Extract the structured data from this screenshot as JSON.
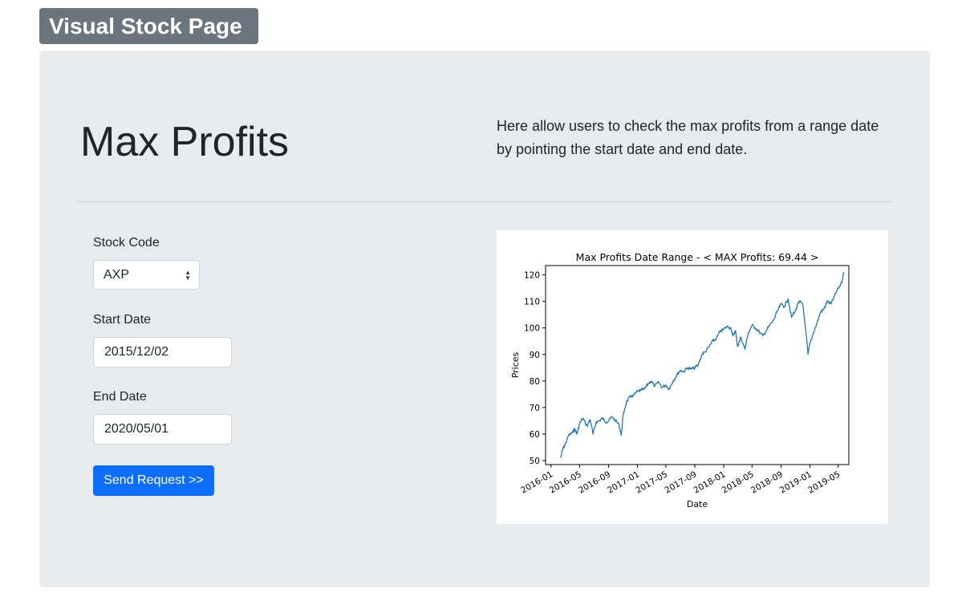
{
  "navbar": {
    "brand": "Visual Stock Page"
  },
  "hero": {
    "title": "Max Profits",
    "description": "Here allow users to check the max profits from a range date by pointing the start date and end date."
  },
  "form": {
    "stock_code_label": "Stock Code",
    "stock_code_value": "AXP",
    "start_date_label": "Start Date",
    "start_date_value": "2015/12/02",
    "end_date_label": "End Date",
    "end_date_value": "2020/05/01",
    "submit_label": "Send Request >>",
    "select_icon": "up-down-chevron-icon",
    "accent_color": "#0d6efd"
  },
  "chart_data": {
    "type": "line",
    "title": "Max Profits Date Range - < MAX Profits: 69.44 >",
    "xlabel": "Date",
    "ylabel": "Prices",
    "x_tick_labels": [
      "2016-01",
      "2016-05",
      "2016-09",
      "2017-01",
      "2017-05",
      "2017-09",
      "2018-01",
      "2018-05",
      "2018-09",
      "2019-01",
      "2019-05"
    ],
    "y_ticks": [
      50,
      60,
      70,
      80,
      90,
      100,
      110,
      120
    ],
    "ylim": [
      48.5,
      123.5
    ],
    "xlim": [
      "2015-12-09",
      "2019-06-15"
    ],
    "grid": false,
    "line_color": "#1f77b4",
    "series": [
      {
        "x": [
          "2016-02-11",
          "2016-02-20",
          "2016-03-01",
          "2016-03-15",
          "2016-04-01",
          "2016-04-10",
          "2016-04-20",
          "2016-05-01",
          "2016-05-15",
          "2016-06-01",
          "2016-06-15",
          "2016-06-27",
          "2016-07-10",
          "2016-07-25",
          "2016-08-05",
          "2016-08-20",
          "2016-09-01",
          "2016-09-15",
          "2016-10-01",
          "2016-10-15",
          "2016-10-25",
          "2016-11-01",
          "2016-11-15",
          "2016-12-01",
          "2016-12-15",
          "2017-01-01",
          "2017-01-15",
          "2017-02-01",
          "2017-02-15",
          "2017-03-01",
          "2017-03-15",
          "2017-04-01",
          "2017-04-15",
          "2017-05-01",
          "2017-05-15",
          "2017-06-01",
          "2017-06-15",
          "2017-07-01",
          "2017-07-15",
          "2017-08-01",
          "2017-08-15",
          "2017-09-01",
          "2017-09-15",
          "2017-10-01",
          "2017-10-15",
          "2017-11-01",
          "2017-11-15",
          "2017-12-01",
          "2017-12-15",
          "2018-01-01",
          "2018-01-15",
          "2018-02-01",
          "2018-02-08",
          "2018-02-20",
          "2018-03-01",
          "2018-03-15",
          "2018-04-01",
          "2018-04-15",
          "2018-05-01",
          "2018-05-15",
          "2018-06-01",
          "2018-06-15",
          "2018-07-01",
          "2018-07-15",
          "2018-08-01",
          "2018-08-15",
          "2018-09-01",
          "2018-09-15",
          "2018-10-01",
          "2018-10-15",
          "2018-11-01",
          "2018-11-15",
          "2018-12-01",
          "2018-12-15",
          "2018-12-24",
          "2019-01-01",
          "2019-01-15",
          "2019-02-01",
          "2019-02-15",
          "2019-03-01",
          "2019-03-15",
          "2019-04-01",
          "2019-04-15",
          "2019-05-01",
          "2019-05-15",
          "2019-05-25"
        ],
        "y": [
          51.0,
          54.5,
          56.0,
          59.5,
          60.5,
          62.0,
          60.0,
          64.0,
          66.0,
          63.0,
          65.5,
          60.0,
          64.5,
          65.0,
          66.0,
          64.5,
          65.0,
          66.5,
          65.0,
          63.5,
          59.5,
          67.0,
          72.0,
          74.0,
          74.5,
          76.0,
          76.5,
          77.0,
          79.0,
          80.0,
          78.0,
          79.5,
          77.5,
          78.5,
          77.0,
          80.0,
          82.0,
          84.0,
          83.5,
          85.0,
          84.5,
          85.0,
          86.0,
          90.0,
          91.0,
          93.0,
          95.0,
          96.0,
          98.5,
          99.5,
          100.5,
          100.0,
          97.0,
          99.0,
          93.0,
          96.5,
          92.0,
          98.0,
          101.0,
          100.0,
          98.5,
          97.0,
          99.0,
          101.0,
          103.0,
          106.0,
          109.0,
          108.0,
          111.0,
          104.0,
          106.5,
          110.0,
          109.0,
          99.0,
          90.0,
          94.0,
          98.0,
          102.0,
          106.0,
          107.0,
          110.0,
          109.0,
          112.0,
          115.0,
          117.0,
          121.0
        ]
      }
    ]
  }
}
